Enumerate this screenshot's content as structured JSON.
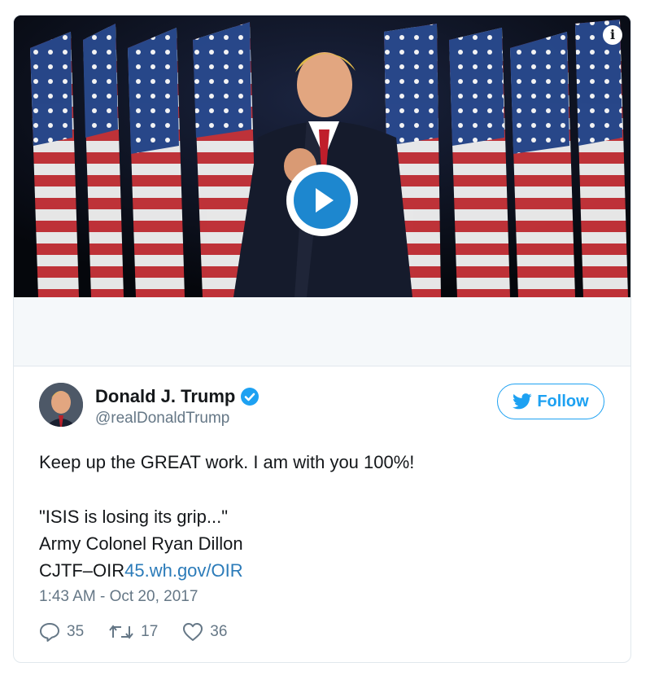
{
  "media": {
    "info_icon": "info-icon",
    "play_icon": "play-icon"
  },
  "author": {
    "display_name": "Donald J. Trump",
    "handle": "@realDonaldTrump",
    "verified_icon": "verified-badge-icon"
  },
  "follow": {
    "label": "Follow",
    "icon": "twitter-bird-icon"
  },
  "tweet": {
    "line1": "Keep up the GREAT work. I am with you 100%!",
    "line2": "\"ISIS is losing its grip...\"",
    "line3": "Army Colonel Ryan Dillon",
    "line4_prefix": "CJTF–OIR",
    "line4_link": "45.wh.gov/OIR",
    "timestamp": "1:43 AM - Oct 20, 2017"
  },
  "actions": {
    "replies": "35",
    "retweets": "17",
    "likes": "36"
  },
  "colors": {
    "accent": "#1da1f2",
    "link": "#2b7bb9",
    "muted": "#657786",
    "play": "#1d87cf"
  }
}
